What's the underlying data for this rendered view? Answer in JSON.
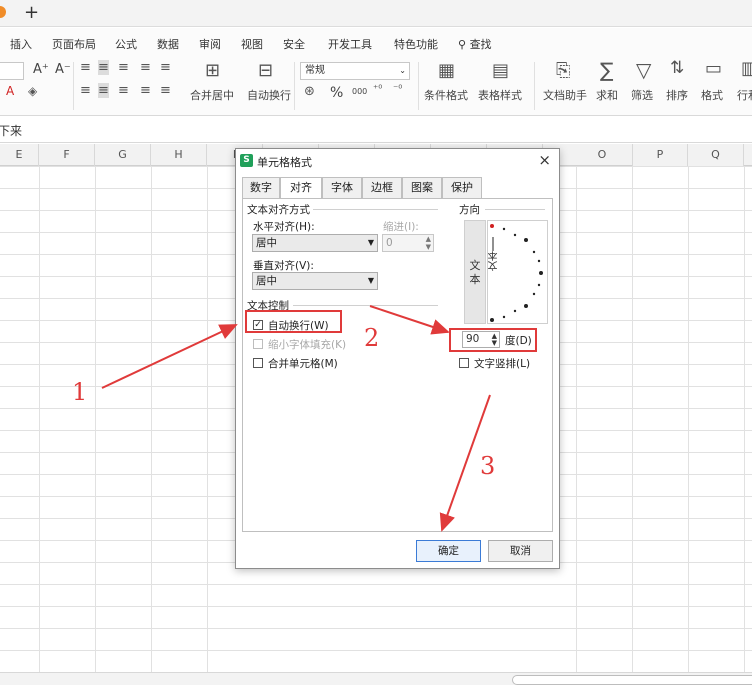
{
  "tabbar": {
    "new_tab": "+"
  },
  "menu": [
    "插入",
    "页面布局",
    "公式",
    "数据",
    "审阅",
    "视图",
    "安全",
    "开发工具",
    "特色功能",
    "查找"
  ],
  "ribbon": {
    "font_size_up": "A⁺",
    "font_size_down": "A⁻",
    "number_format": "常规",
    "merge_center": "合并居中",
    "wrap_text": "自动换行",
    "percent": "%",
    "thousands": "000",
    "cond_format": "条件格式",
    "table_style": "表格样式",
    "doc_helper": "文档助手",
    "sum": "求和",
    "filter": "筛选",
    "sort": "排序",
    "format": "格式",
    "row_col": "行和"
  },
  "formula_bar": {
    "text": "下来"
  },
  "columns": [
    "E",
    "F",
    "G",
    "H",
    "I",
    "J",
    "K",
    "L",
    "M",
    "N",
    "O",
    "P",
    "Q"
  ],
  "dialog": {
    "title": "单元格格式",
    "close": "×",
    "tabs": [
      "数字",
      "对齐",
      "字体",
      "边框",
      "图案",
      "保护"
    ],
    "active_tab": "对齐",
    "text_align_group": "文本对齐方式",
    "h_align_label": "水平对齐(H):",
    "h_align_value": "居中",
    "indent_label": "缩进(I):",
    "indent_value": "0",
    "v_align_label": "垂直对齐(V):",
    "v_align_value": "居中",
    "text_control_group": "文本控制",
    "wrap_label": "自动换行(W)",
    "wrap_checked": true,
    "shrink_label": "缩小字体填充(K)",
    "merge_label": "合并单元格(M)",
    "orientation_group": "方向",
    "orient_text": "文本",
    "dial_text": "文本",
    "degree_value": "90",
    "degree_label": "度(D)",
    "vertical_text_label": "文字竖排(L)",
    "ok": "确定",
    "cancel": "取消"
  },
  "annotations": {
    "one": "1",
    "two": "2",
    "three": "3",
    "color": "#e03a3a"
  }
}
